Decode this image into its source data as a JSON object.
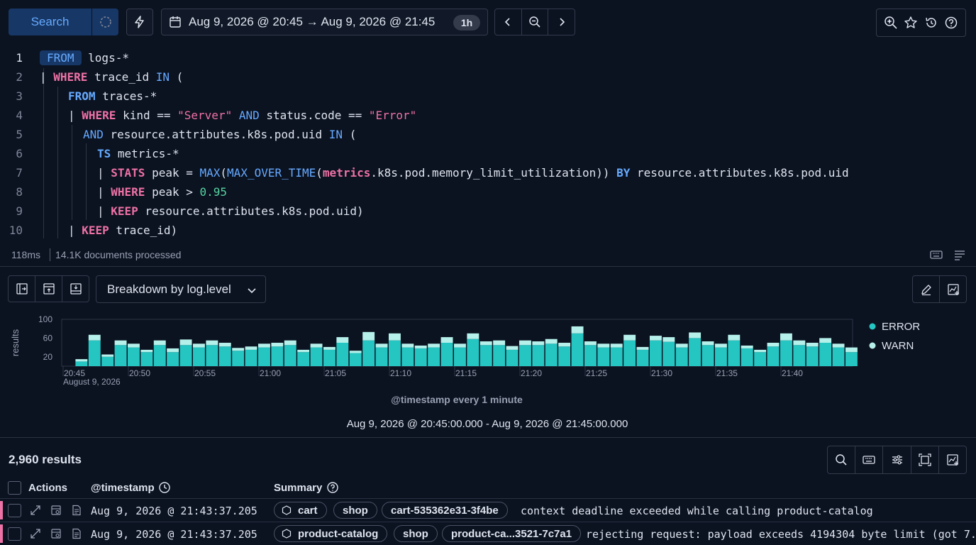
{
  "toolbar": {
    "search_label": "Search",
    "date_range": "Aug 9, 2026 @ 20:45 → Aug 9, 2026 @ 21:45",
    "interval_badge": "1h"
  },
  "editor": {
    "lines": [
      {
        "n": "1"
      },
      {
        "n": "2"
      },
      {
        "n": "3"
      },
      {
        "n": "4"
      },
      {
        "n": "5"
      },
      {
        "n": "6"
      },
      {
        "n": "7"
      },
      {
        "n": "8"
      },
      {
        "n": "9"
      },
      {
        "n": "10"
      }
    ]
  },
  "status": {
    "duration": "118ms",
    "documents": "14.1K documents processed"
  },
  "chart_controls": {
    "breakdown_label": "Breakdown by log.level"
  },
  "chart_data": {
    "type": "bar",
    "stacked": true,
    "ylabel": "results",
    "xlabel": "@timestamp every 1 minute",
    "time_range": "Aug 9, 2026 @ 20:45:00.000 - Aug 9, 2026 @ 21:45:00.000",
    "date_label": "August 9, 2026",
    "yticks": [
      100,
      60,
      20
    ],
    "ylim": [
      0,
      100
    ],
    "xticks": [
      "20:45",
      "20:50",
      "20:55",
      "21:00",
      "21:05",
      "21:10",
      "21:15",
      "21:20",
      "21:25",
      "21:30",
      "21:35",
      "21:40"
    ],
    "legend": [
      "ERROR",
      "WARN"
    ],
    "legend_position": "right",
    "colors": {
      "ERROR": "#25c5c2",
      "WARN": "#b5f0ea"
    },
    "series": [
      {
        "name": "ERROR",
        "values": [
          0,
          10,
          55,
          20,
          45,
          40,
          30,
          45,
          30,
          45,
          40,
          45,
          42,
          33,
          35,
          40,
          42,
          45,
          30,
          40,
          35,
          50,
          28,
          55,
          40,
          55,
          40,
          38,
          40,
          50,
          40,
          58,
          45,
          45,
          35,
          45,
          45,
          48,
          42,
          70,
          45,
          40,
          40,
          55,
          35,
          55,
          52,
          40,
          60,
          45,
          40,
          55,
          38,
          30,
          42,
          55,
          45,
          42,
          50,
          40,
          30
        ]
      },
      {
        "name": "WARN",
        "values": [
          0,
          5,
          12,
          5,
          10,
          8,
          5,
          10,
          8,
          12,
          8,
          10,
          8,
          6,
          7,
          8,
          8,
          10,
          5,
          8,
          6,
          12,
          5,
          18,
          8,
          15,
          8,
          6,
          8,
          12,
          8,
          12,
          8,
          10,
          8,
          10,
          8,
          10,
          8,
          15,
          8,
          8,
          8,
          12,
          6,
          10,
          10,
          8,
          12,
          8,
          8,
          12,
          6,
          5,
          8,
          15,
          10,
          8,
          10,
          8,
          10
        ]
      }
    ]
  },
  "results": {
    "count_label": "2,960 results",
    "columns": {
      "actions": "Actions",
      "timestamp": "@timestamp",
      "summary": "Summary"
    },
    "rows": [
      {
        "timestamp": "Aug 9, 2026 @ 21:43:37.205",
        "service": "cart",
        "namespace": "shop",
        "pod": "cart-535362e31-3f4be",
        "message": "context deadline exceeded while calling product-catalog"
      },
      {
        "timestamp": "Aug 9, 2026 @ 21:43:37.205",
        "service": "product-catalog",
        "namespace": "shop",
        "pod": "product-ca...3521-7c7a1",
        "message": "rejecting request: payload exceeds 4194304 byte limit (got 7..."
      }
    ]
  }
}
